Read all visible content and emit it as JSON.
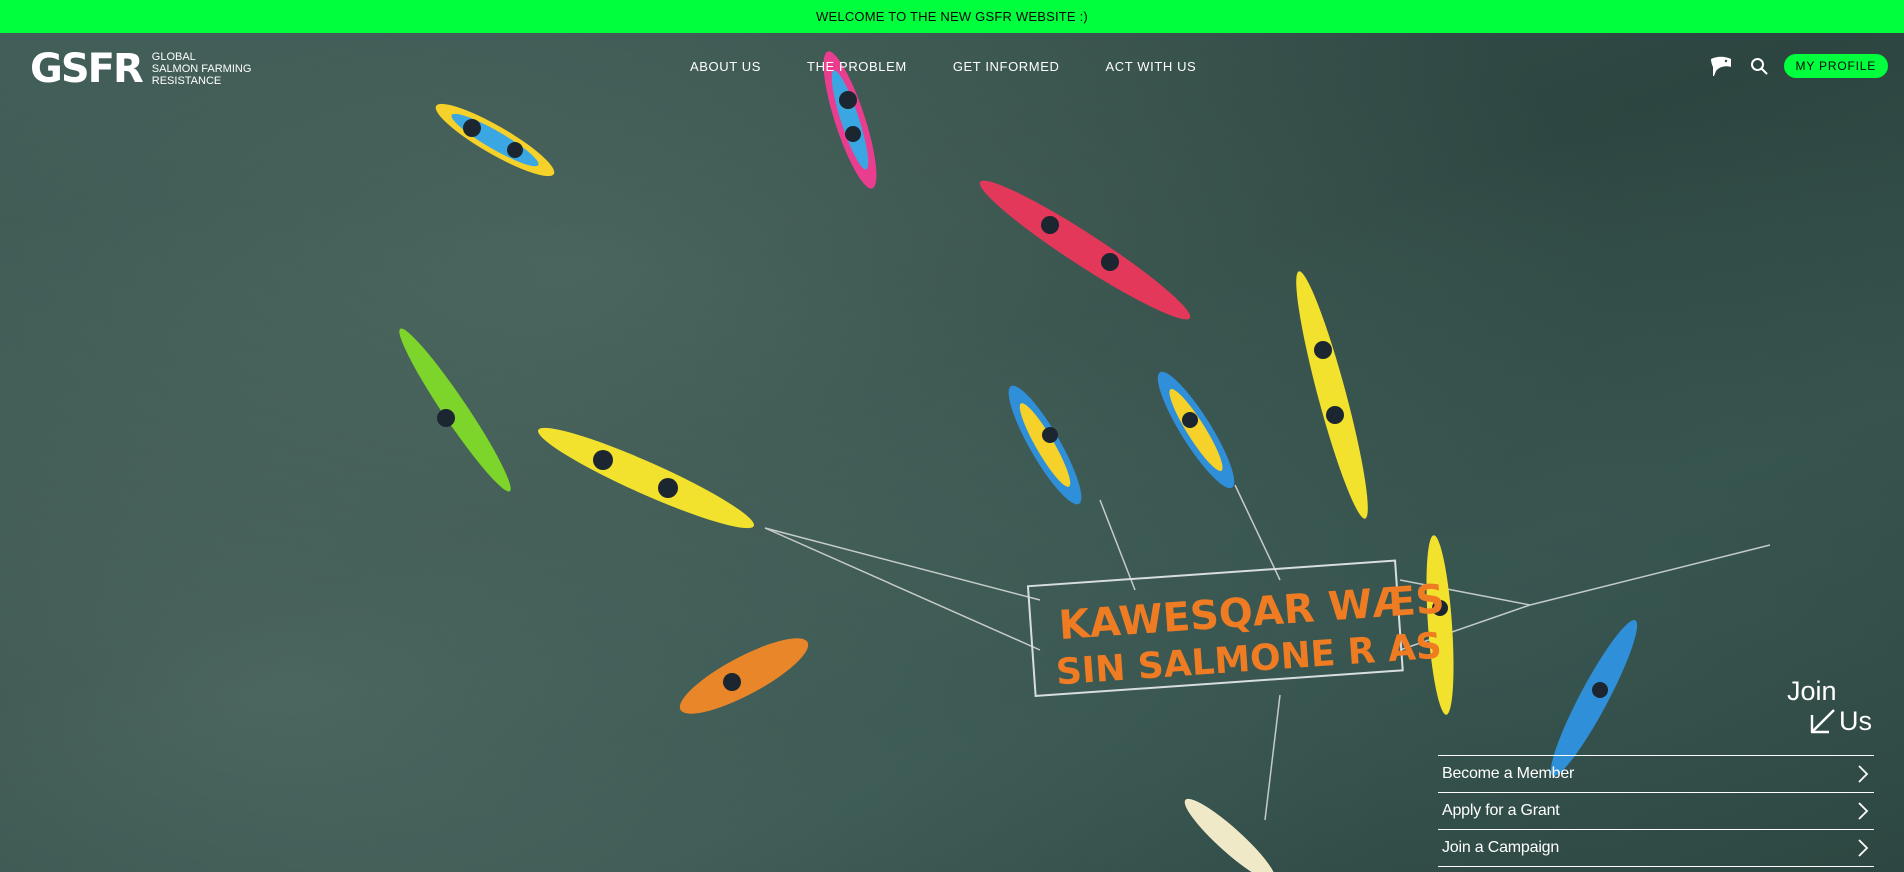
{
  "announcement": {
    "text": "WELCOME TO THE NEW GSFR WEBSITE :)"
  },
  "logo": {
    "mark": "GSFR",
    "lines": [
      "GLOBAL",
      "SALMON FARMING",
      "RESISTANCE"
    ]
  },
  "nav": {
    "items": [
      {
        "label": "ABOUT US"
      },
      {
        "label": "THE PROBLEM"
      },
      {
        "label": "GET INFORMED"
      },
      {
        "label": "ACT WITH US"
      }
    ]
  },
  "header_actions": {
    "language_icon": "fish-flag-icon",
    "search_icon": "search-icon",
    "profile_label": "MY PROFILE"
  },
  "hero": {
    "banner_line1": "KAWESQAR WÆS",
    "banner_line2": "SIN SALMONE R AS"
  },
  "join": {
    "title_word1": "Join",
    "title_word2": "Us",
    "items": [
      {
        "label": "Become a Member"
      },
      {
        "label": "Apply for a Grant"
      },
      {
        "label": "Join a Campaign"
      }
    ]
  },
  "colors": {
    "accent": "#00ff3c",
    "text_light": "#ffffff",
    "water": "#2f4843"
  }
}
